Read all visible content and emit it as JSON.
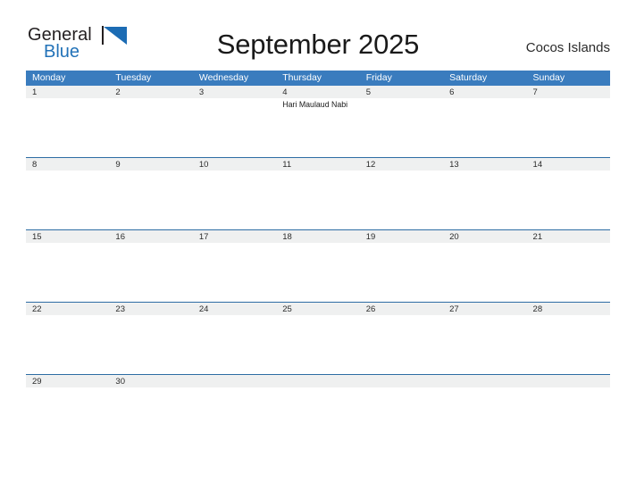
{
  "brand": {
    "name_part1": "General",
    "name_part2": "Blue",
    "accent_color": "#2272b8",
    "flag_icon": "flag-icon"
  },
  "header": {
    "title": "September 2025",
    "location": "Cocos Islands"
  },
  "calendar": {
    "header_bg": "#3a7cbe",
    "band_bg": "#eff0f0",
    "row_border": "#2e6da4",
    "weekdays": [
      "Monday",
      "Tuesday",
      "Wednesday",
      "Thursday",
      "Friday",
      "Saturday",
      "Sunday"
    ],
    "weeks": [
      {
        "days": [
          {
            "number": "1",
            "events": []
          },
          {
            "number": "2",
            "events": []
          },
          {
            "number": "3",
            "events": []
          },
          {
            "number": "4",
            "events": [
              "Hari Maulaud Nabi"
            ]
          },
          {
            "number": "5",
            "events": []
          },
          {
            "number": "6",
            "events": []
          },
          {
            "number": "7",
            "events": []
          }
        ]
      },
      {
        "days": [
          {
            "number": "8",
            "events": []
          },
          {
            "number": "9",
            "events": []
          },
          {
            "number": "10",
            "events": []
          },
          {
            "number": "11",
            "events": []
          },
          {
            "number": "12",
            "events": []
          },
          {
            "number": "13",
            "events": []
          },
          {
            "number": "14",
            "events": []
          }
        ]
      },
      {
        "days": [
          {
            "number": "15",
            "events": []
          },
          {
            "number": "16",
            "events": []
          },
          {
            "number": "17",
            "events": []
          },
          {
            "number": "18",
            "events": []
          },
          {
            "number": "19",
            "events": []
          },
          {
            "number": "20",
            "events": []
          },
          {
            "number": "21",
            "events": []
          }
        ]
      },
      {
        "days": [
          {
            "number": "22",
            "events": []
          },
          {
            "number": "23",
            "events": []
          },
          {
            "number": "24",
            "events": []
          },
          {
            "number": "25",
            "events": []
          },
          {
            "number": "26",
            "events": []
          },
          {
            "number": "27",
            "events": []
          },
          {
            "number": "28",
            "events": []
          }
        ]
      },
      {
        "days": [
          {
            "number": "29",
            "events": []
          },
          {
            "number": "30",
            "events": []
          },
          {
            "number": "",
            "events": []
          },
          {
            "number": "",
            "events": []
          },
          {
            "number": "",
            "events": []
          },
          {
            "number": "",
            "events": []
          },
          {
            "number": "",
            "events": []
          }
        ]
      }
    ]
  }
}
